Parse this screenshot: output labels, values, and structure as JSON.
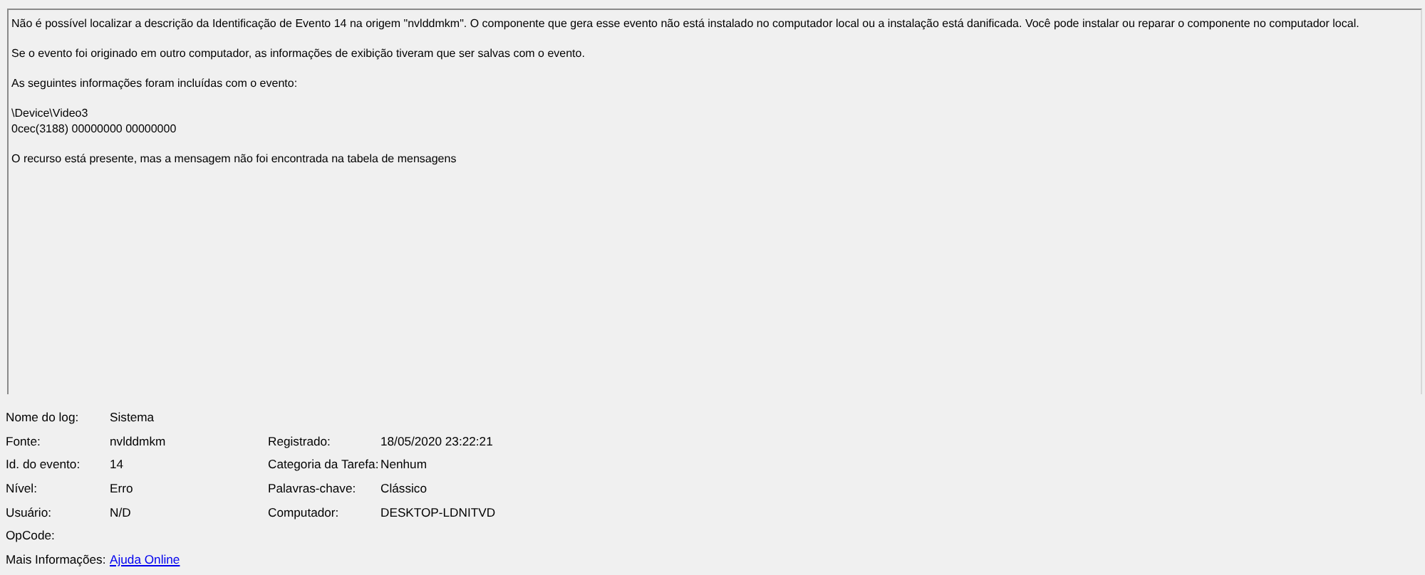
{
  "description": {
    "paragraphs": [
      [
        "Não é possível localizar a descrição da Identificação de Evento 14 na origem \"nvlddmkm\". O componente que gera esse evento não está instalado no computador local ou a instalação está danificada. Você pode instalar ou reparar o componente no computador local."
      ],
      [
        "Se o evento foi originado em outro computador, as informações de exibição tiveram que ser salvas com o evento."
      ],
      [
        "As seguintes informações foram incluídas com o evento:"
      ],
      [
        "\\Device\\Video3",
        "0cec(3188) 00000000 00000000"
      ],
      [
        "O recurso está presente, mas a mensagem não foi encontrada na tabela de mensagens"
      ]
    ]
  },
  "details": {
    "rows": [
      [
        {
          "label": "Nome do log:",
          "value": "Sistema",
          "kind": "text"
        }
      ],
      [
        {
          "label": "Fonte:",
          "value": "nvlddmkm",
          "kind": "text"
        },
        {
          "label": "Registrado:",
          "value": "18/05/2020 23:22:21",
          "kind": "text"
        }
      ],
      [
        {
          "label": "Id. do evento:",
          "value": "14",
          "kind": "text"
        },
        {
          "label": "Categoria da Tarefa:",
          "value": "Nenhum",
          "kind": "text"
        }
      ],
      [
        {
          "label": "Nível:",
          "value": "Erro",
          "kind": "text"
        },
        {
          "label": "Palavras-chave:",
          "value": "Clássico",
          "kind": "text"
        }
      ],
      [
        {
          "label": "Usuário:",
          "value": "N/D",
          "kind": "text"
        },
        {
          "label": "Computador:",
          "value": "DESKTOP-LDNITVD",
          "kind": "text"
        }
      ],
      [
        {
          "label": "OpCode:"
        }
      ],
      [
        {
          "label": "Mais Informações:",
          "value": "Ajuda Online",
          "kind": "link"
        }
      ]
    ]
  }
}
